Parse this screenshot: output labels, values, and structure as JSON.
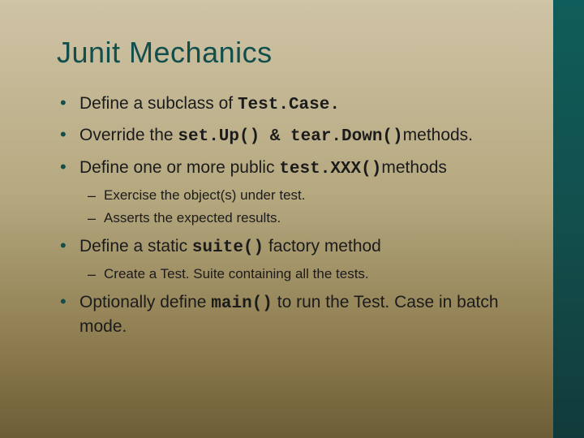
{
  "title": "Junit Mechanics",
  "bullets": {
    "b1": {
      "pre": "Define a subclass of ",
      "code": "Test.Case.",
      "post": ""
    },
    "b2": {
      "pre": "Override the ",
      "code": "set.Up() & tear.Down()",
      "post": "methods."
    },
    "b3": {
      "pre": "Define one or more public ",
      "code": "test.XXX()",
      "post": "methods",
      "sub": {
        "s1": "Exercise the object(s) under test.",
        "s2": "Asserts the expected results."
      }
    },
    "b4": {
      "pre": "Define a static ",
      "code": "suite()",
      "post": " factory method",
      "sub": {
        "s1": " Create a Test. Suite containing all the tests."
      }
    },
    "b5": {
      "pre": "Optionally define ",
      "code": "main()",
      "post": " to  run the Test. Case in batch mode."
    }
  }
}
